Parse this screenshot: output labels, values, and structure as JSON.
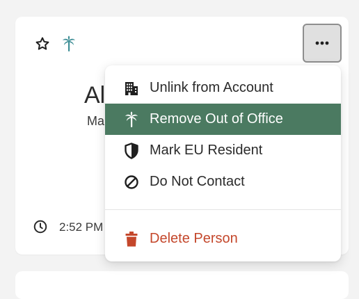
{
  "card": {
    "name": "Al",
    "subtitle": "Ma",
    "local_time": "2:52 PM"
  },
  "icons": {
    "favorite": "star-outline-icon",
    "out_of_office": "palm-tree-icon",
    "more": "ellipsis-icon",
    "clock": "clock-icon"
  },
  "menu": {
    "items": [
      {
        "label": "Unlink from Account",
        "icon": "building-icon"
      },
      {
        "label": "Remove Out of Office",
        "icon": "palm-tree-icon",
        "highlighted": true
      },
      {
        "label": "Mark EU Resident",
        "icon": "shield-icon"
      },
      {
        "label": "Do Not Contact",
        "icon": "prohibited-icon"
      }
    ],
    "danger_item": {
      "label": "Delete Person",
      "icon": "trash-icon"
    }
  },
  "colors": {
    "highlight": "#4b7a61",
    "danger": "#c4472b",
    "palm_badge": "#3f8f96"
  }
}
